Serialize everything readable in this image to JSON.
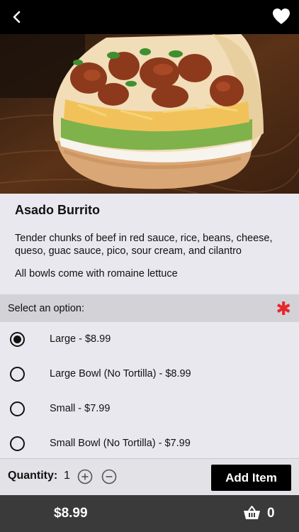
{
  "header": {
    "back_icon": "chevron-left-icon",
    "favorite_icon": "heart-icon"
  },
  "item": {
    "title": "Asado Burrito",
    "description": "Tender chunks of beef in red sauce, rice, beans, cheese, queso, guac sauce, pico, sour cream, and cilantro",
    "note": "All bowls come with romaine lettuce"
  },
  "options": {
    "header": "Select an option:",
    "required_marker": "✱",
    "required_color": "#e8262b",
    "items": [
      {
        "label": "Large - $8.99",
        "selected": true
      },
      {
        "label": "Large Bowl (No Tortilla) - $8.99",
        "selected": false
      },
      {
        "label": "Small - $7.99",
        "selected": false
      },
      {
        "label": "Small Bowl (No Tortilla) - $7.99",
        "selected": false
      }
    ]
  },
  "quantity": {
    "label": "Quantity:",
    "value": "1",
    "increment_icon": "plus-circle-icon",
    "decrement_icon": "minus-circle-icon"
  },
  "actions": {
    "add_label": "Add Item"
  },
  "footer": {
    "total": "$8.99",
    "cart_icon": "basket-icon",
    "cart_count": "0"
  }
}
